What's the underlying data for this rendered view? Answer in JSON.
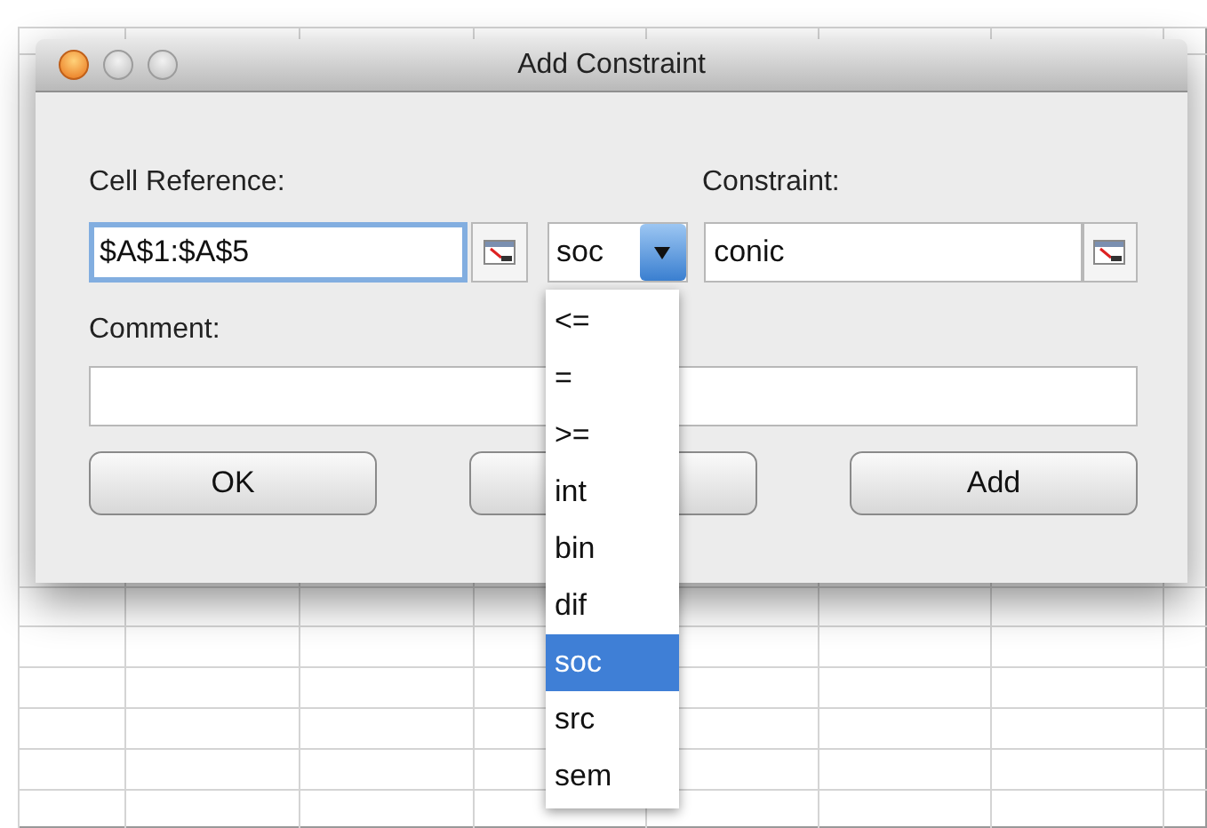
{
  "window": {
    "title": "Add Constraint",
    "buttons": [
      {
        "kind": "close"
      },
      {
        "kind": "minimize"
      },
      {
        "kind": "zoom"
      }
    ]
  },
  "cell_reference": {
    "label": "Cell Reference:",
    "value": "$A$1:$A$5",
    "focused": true
  },
  "relation": {
    "value": "soc",
    "expanded": true,
    "options": [
      {
        "label": "<=",
        "selected": false
      },
      {
        "label": "=",
        "selected": false
      },
      {
        "label": ">=",
        "selected": false
      },
      {
        "label": "int",
        "selected": false
      },
      {
        "label": "bin",
        "selected": false
      },
      {
        "label": "dif",
        "selected": false
      },
      {
        "label": "soc",
        "selected": true
      },
      {
        "label": "src",
        "selected": false
      },
      {
        "label": "sem",
        "selected": false
      }
    ]
  },
  "constraint": {
    "label": "Constraint:",
    "value": "conic"
  },
  "comment": {
    "label": "Comment:"
  },
  "buttons": [
    {
      "label": "OK",
      "covered": false
    },
    {
      "covered": true
    },
    {
      "label": "Add",
      "covered": false
    }
  ]
}
